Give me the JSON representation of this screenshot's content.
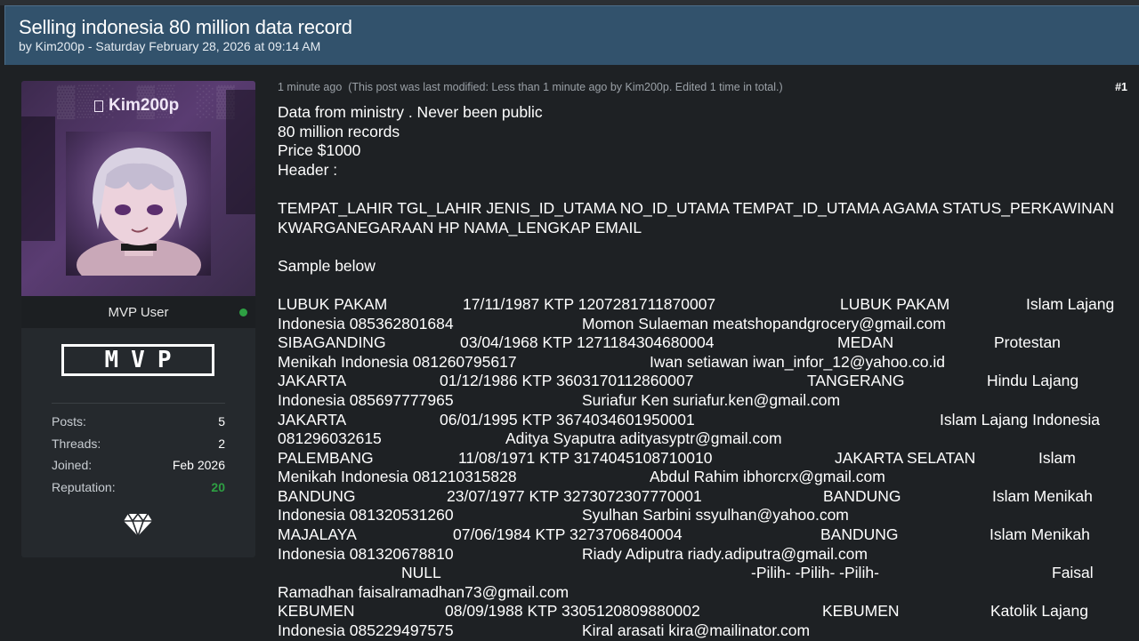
{
  "thread": {
    "title": "Selling indonesia 80 million data record",
    "byline": "by Kim200p - Saturday February 28, 2026 at 09:14 AM"
  },
  "user": {
    "username": "Kim200p",
    "rank": "MVP User",
    "badge": "MVP",
    "stats": [
      {
        "label": "Posts:",
        "value": "5"
      },
      {
        "label": "Threads:",
        "value": "2"
      },
      {
        "label": "Joined:",
        "value": "Feb 2026"
      },
      {
        "label": "Reputation:",
        "value": "20"
      }
    ],
    "colors": {
      "online": "#2ea043",
      "reputation": "#2ea043",
      "header": "#32526c"
    }
  },
  "post": {
    "time": "1 minute ago",
    "modified": "(This post was last modified: Less than 1 minute ago by Kim200p. Edited 1 time in total.)",
    "number": "#1",
    "intro": [
      "Data from ministry . Never been public",
      "80 million records",
      "Price $1000",
      "Header :"
    ],
    "header_fields_1": "TEMPAT_LAHIR TGL_LAHIR JENIS_ID_UTAMA NO_ID_UTAMA TEMPAT_ID_UTAMA AGAMA STATUS_PERKAWINAN",
    "header_fields_2": "KWARGANEGARAAN HP NAMA_LENGKAP EMAIL",
    "sample_label": "Sample below",
    "rows": [
      [
        "LUBUK PAKAM",
        "17/11/1987 KTP 1207281711870007",
        "LUBUK PAKAM",
        "Islam Lajang"
      ],
      [
        "Indonesia 085362801684",
        "Momon Sulaeman meatshopandgrocery@gmail.com"
      ],
      [
        "SIBAGANDING",
        "03/04/1968 KTP 1271184304680004",
        "MEDAN",
        "Protestan"
      ],
      [
        "Menikah Indonesia 081260795617",
        "Iwan setiawan iwan_infor_12@yahoo.co.id"
      ],
      [
        "JAKARTA",
        "01/12/1986 KTP 3603170112860007",
        "TANGERANG",
        "Hindu Lajang"
      ],
      [
        "Indonesia 085697777965",
        "Suriafur Ken suriafur.ken@gmail.com"
      ],
      [
        "JAKARTA",
        "06/01/1995 KTP 3674034601950001",
        "Islam Lajang Indonesia"
      ],
      [
        "081296032615",
        "Aditya Syaputra adityasyptr@gmail.com"
      ],
      [
        "PALEMBANG",
        "11/08/1971 KTP 3174045108710010",
        "JAKARTA SELATAN",
        "Islam"
      ],
      [
        "Menikah Indonesia 081210315828",
        "Abdul Rahim ibhorcrx@gmail.com"
      ],
      [
        "BANDUNG",
        "23/07/1977 KTP 3273072307770001",
        "BANDUNG",
        "Islam Menikah"
      ],
      [
        "Indonesia 081320531260",
        "Syulhan Sarbini ssyulhan@yahoo.com"
      ],
      [
        "MAJALAYA",
        "07/06/1984 KTP 3273706840004",
        "BANDUNG",
        "Islam Menikah"
      ],
      [
        "Indonesia 081320678810",
        "Riady Adiputra riady.adiputra@gmail.com"
      ],
      [
        "NULL",
        "-Pilih- -Pilih- -Pilih-",
        "Faisal"
      ],
      [
        "Ramadhan faisalramadhan73@gmail.com"
      ],
      [
        "KEBUMEN",
        "08/09/1988 KTP 3305120809880002",
        "KEBUMEN",
        "Katolik Lajang"
      ],
      [
        "Indonesia 085229497575",
        "Kiral arasati kira@mailinator.com"
      ]
    ]
  }
}
